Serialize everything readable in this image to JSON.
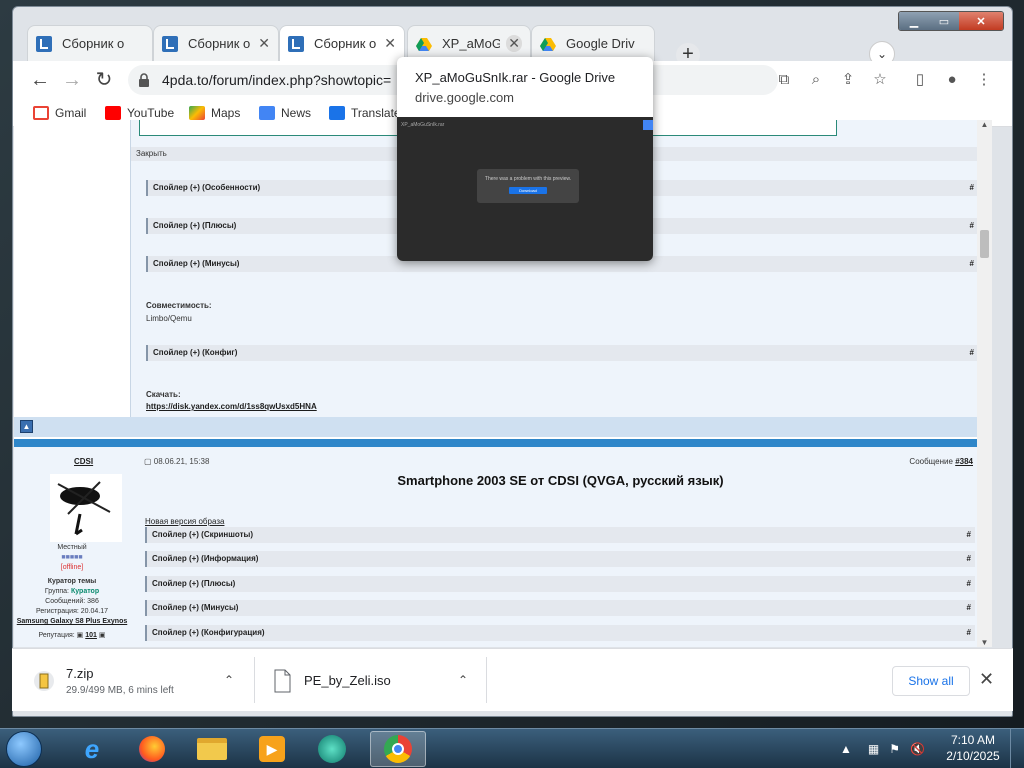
{
  "tabs": [
    {
      "title": "Сборник о",
      "favicon": "4pda-icon",
      "active": false
    },
    {
      "title": "Сборник о",
      "favicon": "4pda-icon",
      "active": false
    },
    {
      "title": "Сборник о",
      "favicon": "4pda-icon",
      "active": true
    },
    {
      "title": "XP_aMoGu",
      "favicon": "google-drive-icon",
      "active": false
    },
    {
      "title": "Google Driv",
      "favicon": "google-drive-icon",
      "active": false
    }
  ],
  "address": {
    "url": "4pda.to/forum/index.php?showtopic="
  },
  "bookmarks": [
    {
      "label": "Gmail",
      "icon": "gmail-icon"
    },
    {
      "label": "YouTube",
      "icon": "youtube-icon"
    },
    {
      "label": "Maps",
      "icon": "maps-icon"
    },
    {
      "label": "News",
      "icon": "news-icon"
    },
    {
      "label": "Translate",
      "icon": "translate-icon"
    }
  ],
  "popup": {
    "title": "XP_aMoGuSnIk.rar - Google Drive",
    "url": "drive.google.com",
    "preview_header": "XP_aMoGuSnIk.rar",
    "preview_message": "There was a problem with this preview.",
    "preview_button": "Download"
  },
  "page": {
    "close": "Закрыть",
    "spoilers_top": [
      "Спойлер (+) (Особенности)",
      "Спойлер (+) (Плюсы)",
      "Спойлер (+) (Минусы)"
    ],
    "compat_label": "Совместимость:",
    "compat_value": "Limbo/Qemu",
    "spoiler_config": "Спойлер (+) (Конфиг)",
    "download_label": "Скачать:",
    "download_link": "https://disk.yandex.com/d/1ss8qwUsxd5HNA",
    "hash": "#",
    "post": {
      "author": "CDSI",
      "date": "08.06.21, 15:38",
      "message_label": "Сообщение",
      "message_number": "#384",
      "title": "Smartphone 2003 SE от CDSI (QVGA, русский язык)",
      "new_version": "Новая версия образа",
      "rank": "Местный",
      "status": "[offline]",
      "curator": "Куратор темы",
      "group_label": "Группа:",
      "group_value": "Куратор",
      "messages_label": "Сообщений:",
      "messages_value": "386",
      "reg_label": "Регистрация:",
      "reg_value": "20.04.17",
      "device": "Samsung Galaxy S8 Plus Exynos",
      "rep_label": "Репутация:",
      "rep_value": "101",
      "spoilers": [
        "Спойлер (+) (Скриншоты)",
        "Спойлер (+) (Информация)",
        "Спойлер (+) (Плюсы)",
        "Спойлер (+) (Минусы)",
        "Спойлер (+) (Конфигурация)"
      ]
    }
  },
  "downloads": [
    {
      "name": "7.zip",
      "status": "29.9/499 MB, 6 mins left"
    },
    {
      "name": "PE_by_Zeli.iso",
      "status": ""
    }
  ],
  "shelf": {
    "show_all": "Show all"
  },
  "taskbar": {
    "time": "7:10 AM",
    "date": "2/10/2025"
  }
}
